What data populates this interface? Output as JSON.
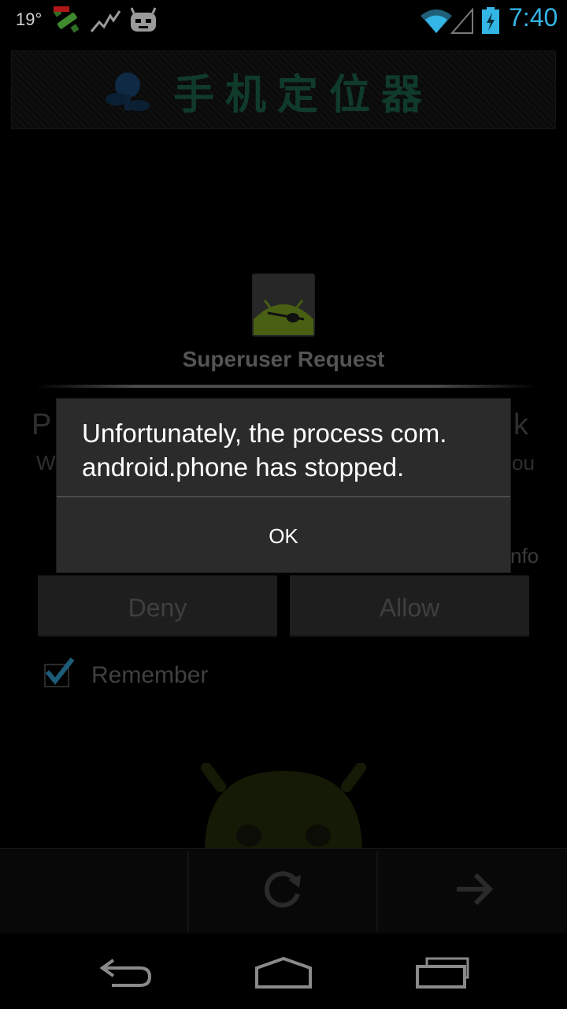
{
  "status_bar": {
    "temperature": "19°",
    "time": "7:40"
  },
  "app": {
    "banner_title": "手机定位器"
  },
  "superuser": {
    "title": "Superuser Request",
    "peek_p": "P",
    "peek_k": "k",
    "peek_w": "W",
    "peek_ou": "ou",
    "peek_nfo": "nfo",
    "deny_label": "Deny",
    "allow_label": "Allow",
    "remember_label": "Remember",
    "remember_checked": true
  },
  "error_dialog": {
    "message_line1": "Unfortunately, the process com.",
    "message_line2": "android.phone has stopped.",
    "ok_label": "OK"
  },
  "colors": {
    "accent": "#33b5e5",
    "dialog_bg": "#2b2b2b"
  }
}
